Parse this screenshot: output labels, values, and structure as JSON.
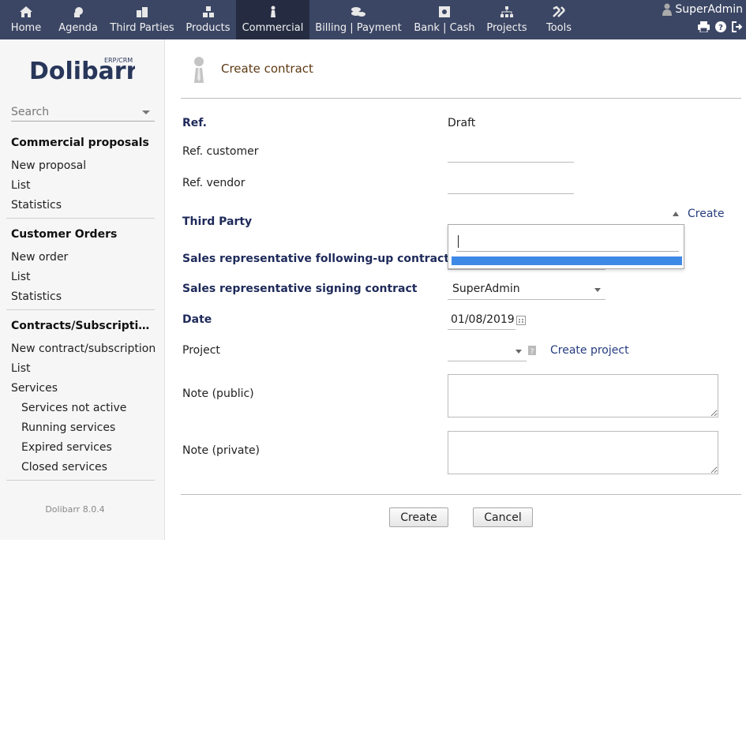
{
  "topmenu": {
    "items": [
      {
        "label": "Home",
        "icon": "home-icon"
      },
      {
        "label": "Agenda",
        "icon": "agenda-icon"
      },
      {
        "label": "Third Parties",
        "icon": "third-parties-icon"
      },
      {
        "label": "Products",
        "icon": "products-icon"
      },
      {
        "label": "Commercial",
        "icon": "commercial-icon",
        "active": true
      },
      {
        "label": "Billing | Payment",
        "icon": "billing-icon"
      },
      {
        "label": "Bank | Cash",
        "icon": "bank-icon"
      },
      {
        "label": "Projects",
        "icon": "projects-icon"
      },
      {
        "label": "Tools",
        "icon": "tools-icon"
      }
    ],
    "user": "SuperAdmin"
  },
  "leftmenu": {
    "search_placeholder": "Search",
    "sections": [
      {
        "title": "Commercial proposals",
        "items": [
          "New proposal",
          "List",
          "Statistics"
        ]
      },
      {
        "title": "Customer Orders",
        "items": [
          "New order",
          "List",
          "Statistics"
        ]
      },
      {
        "title": "Contracts/Subscriptions",
        "items": [
          "New contract/subscription",
          "List",
          "Services"
        ],
        "subitems": [
          "Services not active",
          "Running services",
          "Expired services",
          "Closed services"
        ]
      }
    ],
    "version": "Dolibarr 8.0.4",
    "logo_text": "Dolibarr",
    "logo_sub": "ERP/CRM"
  },
  "form": {
    "title": "Create contract",
    "ref_label": "Ref.",
    "ref_value": "Draft",
    "ref_customer_label": "Ref. customer",
    "ref_vendor_label": "Ref. vendor",
    "third_party_label": "Third Party",
    "third_party_create": "Create",
    "sales_followup_label": "Sales representative following-up contract",
    "sales_signing_label": "Sales representative signing contract",
    "sales_signing_value": "SuperAdmin",
    "date_label": "Date",
    "date_value": "01/08/2019",
    "project_label": "Project",
    "project_create": "Create project",
    "note_public_label": "Note (public)",
    "note_private_label": "Note (private)",
    "create_button": "Create",
    "cancel_button": "Cancel"
  },
  "colors": {
    "topbar": "#3b4664",
    "topbar_active": "#252c41",
    "required_label": "#1e2a5a",
    "link": "#263c7e",
    "highlight": "#3f89e6"
  }
}
